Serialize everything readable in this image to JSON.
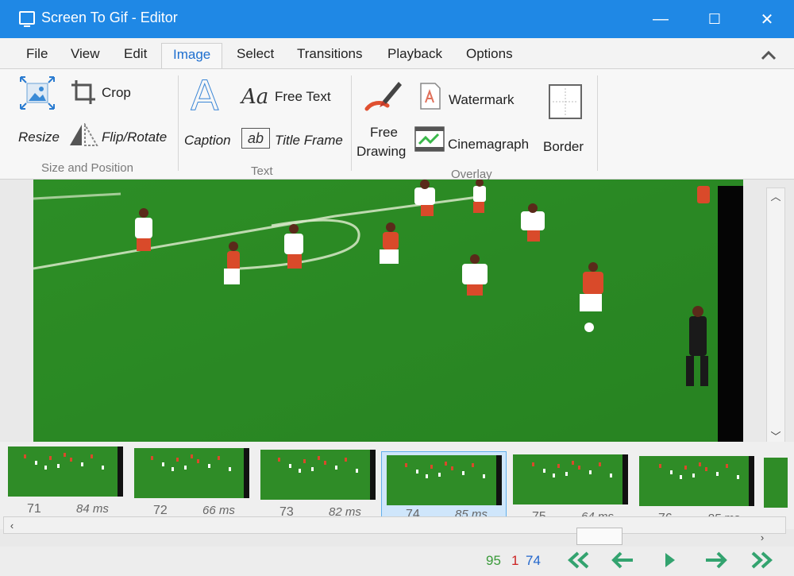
{
  "window": {
    "title": "Screen To Gif - Editor",
    "minimize": "—",
    "maximize": "☐",
    "close": "✕"
  },
  "menu": {
    "tabs": [
      {
        "label": "File"
      },
      {
        "label": "View"
      },
      {
        "label": "Edit"
      },
      {
        "label": "Image"
      },
      {
        "label": "Select"
      },
      {
        "label": "Transitions"
      },
      {
        "label": "Playback"
      },
      {
        "label": "Options"
      }
    ],
    "collapse_icon": "chevron-up-icon"
  },
  "ribbon": {
    "size_and_position": {
      "label": "Size and Position",
      "resize": "Resize",
      "crop": "Crop",
      "flip_rotate": "Flip/Rotate"
    },
    "text": {
      "label": "Text",
      "caption": "Caption",
      "free_text": "Free Text",
      "title_frame": "Title Frame",
      "free_text_glyph": "Aa",
      "title_frame_glyph": "ab",
      "caption_glyph": "A"
    },
    "overlay": {
      "label": "Overlay",
      "free_drawing_line1": "Free",
      "free_drawing_line2": "Drawing",
      "watermark": "Watermark",
      "cinemagraph": "Cinemagraph",
      "border": "Border"
    }
  },
  "frames": [
    {
      "number": "71",
      "delay": "84 ms"
    },
    {
      "number": "72",
      "delay": "66 ms"
    },
    {
      "number": "73",
      "delay": "82 ms"
    },
    {
      "number": "74",
      "delay": "85 ms",
      "selected": true
    },
    {
      "number": "75",
      "delay": "64 ms"
    },
    {
      "number": "76",
      "delay": "85 ms"
    }
  ],
  "status": {
    "total_frames": "95",
    "selected_count": "1",
    "current_frame": "74",
    "colors": {
      "total": "#3a9a3a",
      "selected": "#cc2222",
      "current": "#2266cc"
    }
  }
}
